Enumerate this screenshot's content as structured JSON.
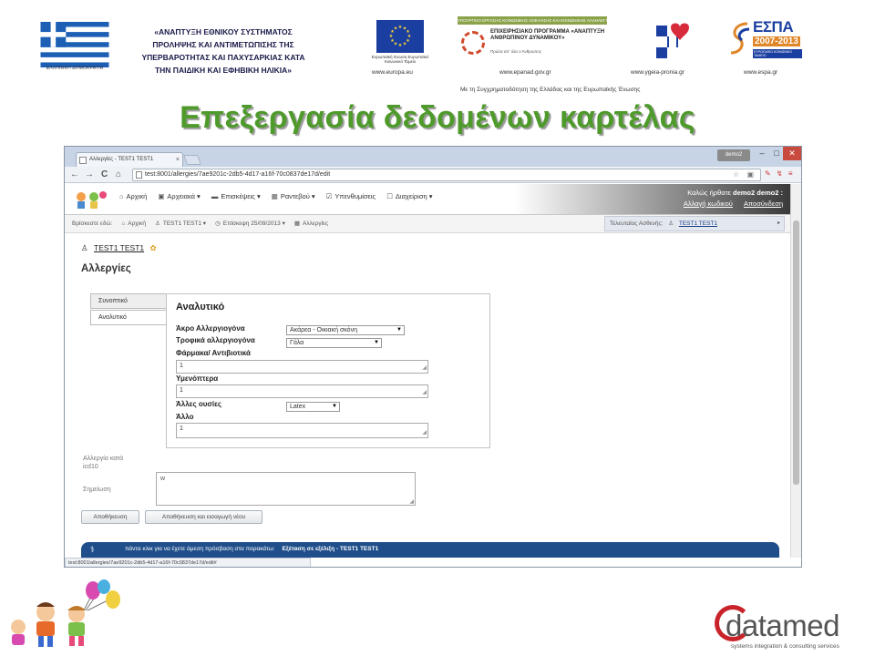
{
  "banner": {
    "greek_flag_caption": "ΕΛΛΗΝΙΚΗ ΔΗΜΟΚΡΑΤΙΑ",
    "program_lines": [
      "«ΑΝΑΠΤΥΞΗ ΕΘΝΙΚΟΥ ΣΥΣΤΗΜΑΤΟΣ",
      "ΠΡΟΛΗΨΗΣ ΚΑΙ ΑΝΤΙΜΕΤΩΠΙΣΗΣ ΤΗΣ",
      "ΥΠΕΡΒΑΡΟΤΗΤΑΣ ΚΑΙ ΠΑΧΥΣΑΡΚΙΑΣ ΚΑΤΑ",
      "ΤΗΝ ΠΑΙΔΙΚΗ ΚΑΙ ΕΦΗΒΙΚΗ ΗΛΙΚΙΑ»"
    ],
    "eu_caption": "Ευρωπαϊκή Ένωση Ευρωπαϊκό Κοινωνικό Ταμείο",
    "eu_url": "www.europa.eu",
    "epanad_bar": "ΥΠΟΥΡΓΕΙΟ ΕΡΓΑΣΙΑΣ ΚΟΙΝΩΝΙΚΗΣ ΑΣΦΑΛΙΣΗΣ ΚΑΙ ΚΟΙΝΩΝΙΚΗΣ ΑΛΛΗΛΕΓΓΥΗΣ",
    "epanad_title": "ΕΠΙΧΕΙΡΗΣΙΑΚΟ ΠΡΟΓΡΑΜΜΑ «ΑΝΑΠΤΥΞΗ ΑΝΘΡΩΠΙΝΟΥ ΔΥΝΑΜΙΚΟΥ»",
    "epanad_sub": "Πρώτα απ' όλα ο Άνθρωπος",
    "epanad_url": "www.epanad.gov.gr",
    "health_url": "www.ygeia-pronia.gr",
    "espa_word": "ΕΣΠΑ",
    "espa_years": "2007-2013",
    "espa_tag": "ΕΥΡΩΠΑΪΚΟ ΚΟΙΝΩΝΙΚΟ ΤΑΜΕΙΟ",
    "espa_url": "www.espa.gr",
    "cofund": "Με τη Συγχρηματοδότηση της Ελλάδας και της Ευρωπαϊκής Ένωσης"
  },
  "slide_title": "Επεξεργασία δεδομένων καρτέλας",
  "browser": {
    "tab_title": "Αλλεργίες - TEST1 TEST1",
    "tab_close": "×",
    "user_pill": "demo2",
    "win_min": "–",
    "win_max": "□",
    "win_close": "✕",
    "nav_back": "←",
    "nav_forward": "→",
    "nav_reload": "C",
    "nav_home": "⌂",
    "url": "test:8001/allergies/7ae9201c-2db5-4d17-a16f-70c0837de17d/edit",
    "url_icons": "☆ ▣",
    "ext_icons": "✎ ↯ ≡",
    "status_url": "test:8001/allergies/7ae9201c-2db5-4d17-a16f-70c0837de17d/edit#"
  },
  "app": {
    "nav_items": [
      {
        "icon": "⌂",
        "label": "Αρχική"
      },
      {
        "icon": "▣",
        "label": "Αρχειακά ▾"
      },
      {
        "icon": "▬",
        "label": "Επισκέψεις ▾"
      },
      {
        "icon": "▦",
        "label": "Ραντεβού ▾"
      },
      {
        "icon": "☑",
        "label": "Υπενθυμίσεις"
      },
      {
        "icon": "☐",
        "label": "Διαχείριση ▾"
      }
    ],
    "welcome": "Καλώς ήρθατε",
    "user_name": "demo2 demo2 :",
    "change_password": "Αλλαγή κωδικού",
    "logout": "Αποσύνδεση",
    "breadcrumb_prefix": "Βρίσκεστε εδώ:",
    "crumbs": [
      {
        "icon": "⌂",
        "label": "Αρχική"
      },
      {
        "icon": "♙",
        "label": "TEST1 TEST1 ▾"
      },
      {
        "icon": "◷",
        "label": "Επίσκεψη 25/09/2013 ▾"
      },
      {
        "icon": "▦",
        "label": "Αλλεργίες"
      }
    ],
    "current_patient_label": "Τελευταίος Ασθενής:",
    "current_patient": "TEST1 TEST1",
    "patient_icon": "♙",
    "patient_name": "TEST1 TEST1",
    "patient_badge": "✿",
    "page_heading": "Αλλεργίες",
    "side_tabs": [
      "Συνοπτικό",
      "Αναλυτικό"
    ],
    "form": {
      "title": "Αναλυτικό",
      "f1_label": "Άκρο Αλλεργιογόνα",
      "f1_value": "Ακάρεα - Οικιακή σκόνη",
      "f2_label": "Τροφικά αλλεργιογόνα",
      "f2_value": "Γάλα",
      "f3_label": "Φάρμακα/ Αντιβιοτικά",
      "f3_value": "1",
      "f4_label": "Υμενόπτερα",
      "f4_value": "1",
      "f5_label": "Άλλες ουσίες",
      "f5_value": "Latex",
      "f6_label": "Άλλο",
      "f6_value": "1"
    },
    "icd_label": "Αλλεργία κατά",
    "icd_code": "icd10",
    "note_label": "Σημείωση",
    "note_value": "w",
    "save_button": "Αποθήκευση",
    "save_new_button": "Αποθήκευση και εισαγωγή νέου",
    "bottom_hint": "πάντα κλικ για να έχετε άμεση πρόσβαση στα παρακάτω:",
    "bottom_status": "Εξέταση σε εξέλιξη - TEST1 TEST1"
  },
  "footer": {
    "datamed_word": "datamed",
    "datamed_tag": "systems integration & consulting services"
  },
  "colors": {
    "title_green": "#4e9a2a",
    "app_blue": "#1f4e8a",
    "datamed_red": "#c9242b"
  }
}
